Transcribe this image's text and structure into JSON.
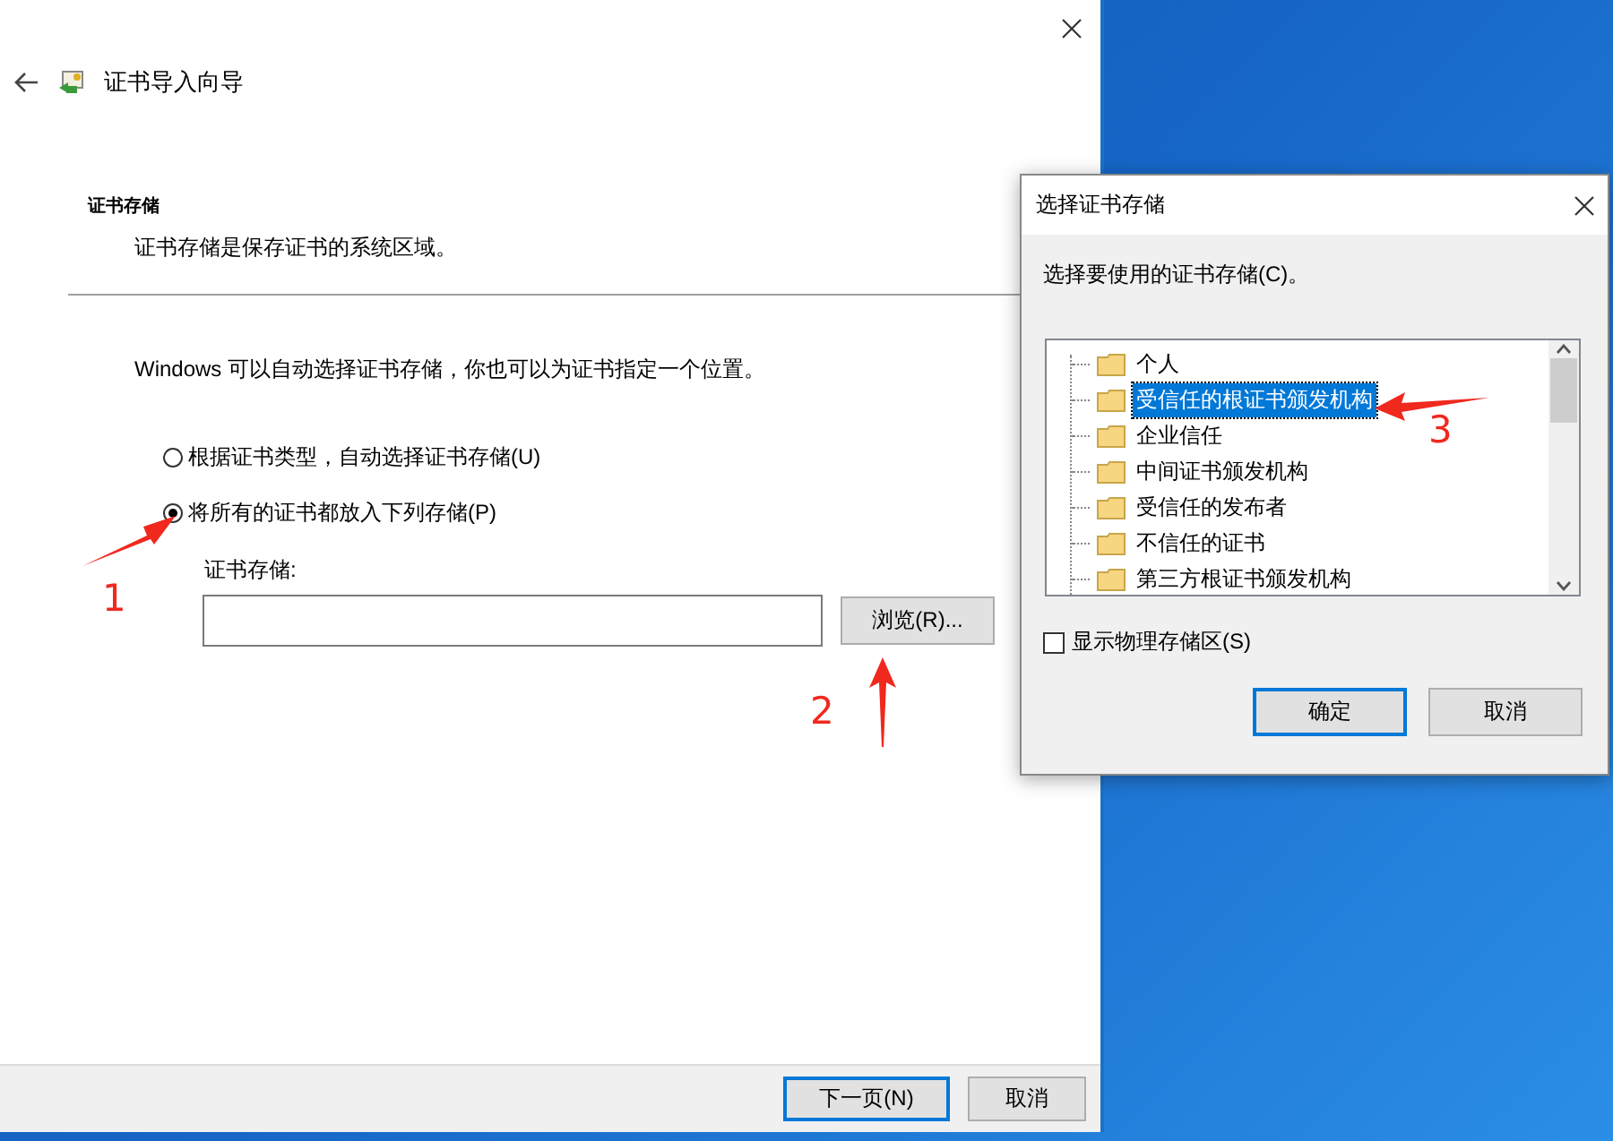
{
  "wizard": {
    "title": "证书导入向导",
    "section_title": "证书存储",
    "section_desc": "证书存储是保存证书的系统区域。",
    "intro": "Windows 可以自动选择证书存储，你也可以为证书指定一个位置。",
    "options": [
      {
        "label": "根据证书类型，自动选择证书存储(U)",
        "selected": false
      },
      {
        "label": "将所有的证书都放入下列存储(P)",
        "selected": true
      }
    ],
    "store_label": "证书存储:",
    "browse_button": "浏览(R)...",
    "buttons": [
      {
        "label": "下一页(N)",
        "default": true
      },
      {
        "label": "取消",
        "default": false
      }
    ]
  },
  "dialog": {
    "title": "选择证书存储",
    "prompt": "选择要使用的证书存储(C)。",
    "stores": [
      {
        "label": "个人",
        "selected": false
      },
      {
        "label": "受信任的根证书颁发机构",
        "selected": true
      },
      {
        "label": "企业信任",
        "selected": false
      },
      {
        "label": "中间证书颁发机构",
        "selected": false
      },
      {
        "label": "受信任的发布者",
        "selected": false
      },
      {
        "label": "不信任的证书",
        "selected": false
      },
      {
        "label": "第三方根证书颁发机构",
        "selected": false
      }
    ],
    "show_physical": {
      "label": "显示物理存储区(S)",
      "checked": false
    },
    "buttons": [
      {
        "label": "确定",
        "default": true
      },
      {
        "label": "取消",
        "default": false
      }
    ]
  },
  "annotations": [
    {
      "label": "1"
    },
    {
      "label": "2"
    },
    {
      "label": "3"
    }
  ]
}
